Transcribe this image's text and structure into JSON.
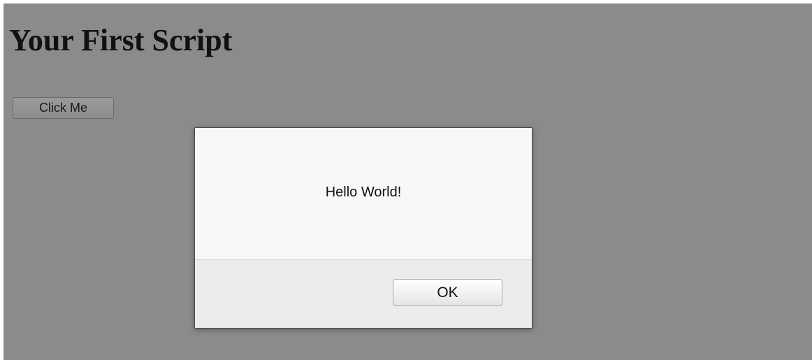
{
  "page": {
    "title": "Your First Script",
    "click_button_label": "Click Me"
  },
  "alert": {
    "message": "Hello World!",
    "ok_label": "OK"
  },
  "colors": {
    "overlay": "#8b8b8b",
    "dialog_body": "#f8f8f8",
    "dialog_footer": "#ececec"
  }
}
